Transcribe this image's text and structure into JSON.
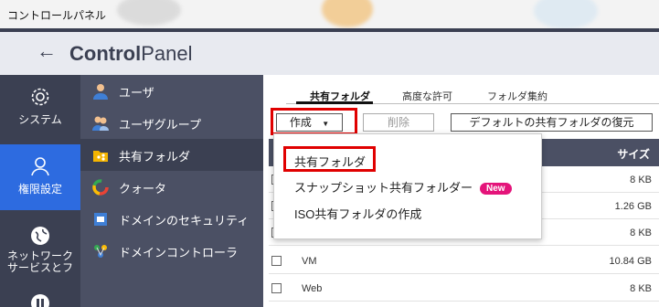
{
  "window": {
    "title": "コントロールパネル"
  },
  "header": {
    "brand_bold": "Control",
    "brand_light": "Panel"
  },
  "rail": [
    {
      "label": "システム",
      "icon": "gear-icon"
    },
    {
      "label": "権限設定",
      "icon": "user-icon"
    },
    {
      "label_line1": "ネットワーク",
      "label_line2": "サービスとフ",
      "icon": "globe-icon"
    }
  ],
  "subnav": [
    {
      "label": "ユーザ",
      "icon": "user-icon"
    },
    {
      "label": "ユーザグループ",
      "icon": "user-group-icon"
    },
    {
      "label": "共有フォルダ",
      "icon": "shared-folder-icon"
    },
    {
      "label": "クォータ",
      "icon": "quota-icon"
    },
    {
      "label": "ドメインのセキュリティ",
      "icon": "domain-security-icon"
    },
    {
      "label": "ドメインコントローラ",
      "icon": "domain-controller-icon"
    }
  ],
  "tabs": [
    "共有フォルダ",
    "高度な許可",
    "フォルダ集約"
  ],
  "toolbar": {
    "create": "作成",
    "delete": "削除",
    "restore": "デフォルトの共有フォルダの復元"
  },
  "table": {
    "size_header": "サイズ",
    "rows": [
      {
        "name": "",
        "size": "8 KB"
      },
      {
        "name": "",
        "size": "1.26 GB"
      },
      {
        "name": "",
        "size": "8 KB"
      },
      {
        "name": "VM",
        "size": "10.84 GB"
      },
      {
        "name": "Web",
        "size": "8 KB"
      }
    ]
  },
  "dropdown": {
    "items": [
      "共有フォルダ",
      "スナップショット共有フォルダー",
      "ISO共有フォルダの作成"
    ],
    "new_badge": "New"
  },
  "colors": {
    "highlight": "#e00000",
    "accent": "#2d6be0",
    "badge": "#e4147a"
  }
}
